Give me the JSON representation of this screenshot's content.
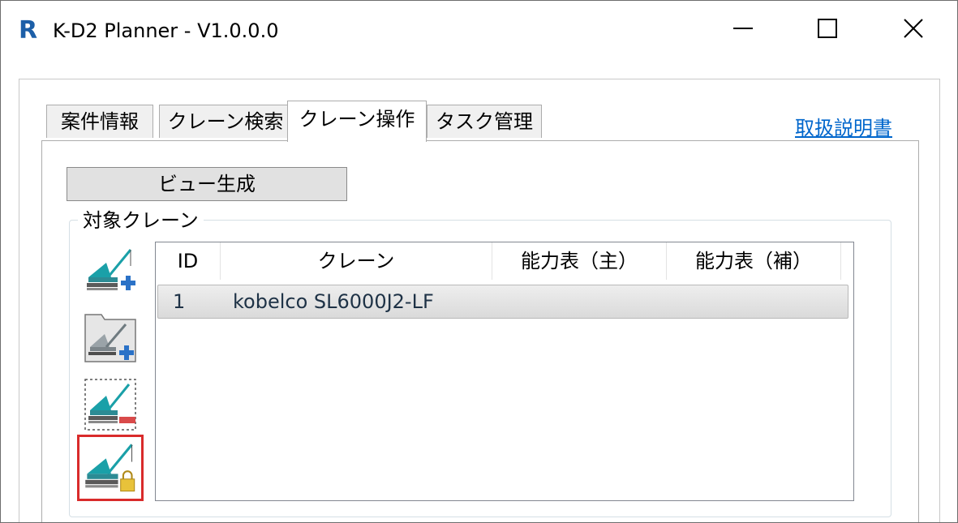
{
  "window": {
    "logo_text": "R",
    "title": "K-D2 Planner - V1.0.0.0",
    "controls": [
      "minimize",
      "maximize",
      "close"
    ]
  },
  "tabs": [
    {
      "label": "案件情報",
      "active": false
    },
    {
      "label": "クレーン検索",
      "active": false
    },
    {
      "label": "クレーン操作",
      "active": true
    },
    {
      "label": "タスク管理",
      "active": false
    }
  ],
  "manual_link": "取扱説明書",
  "panel": {
    "view_button_label": "ビュー生成",
    "group_label": "対象クレーン",
    "side_buttons": [
      {
        "icon": "add-crane-icon",
        "selected": false
      },
      {
        "icon": "add-crane-from-folder-icon",
        "selected": false
      },
      {
        "icon": "remove-crane-icon",
        "selected": false
      },
      {
        "icon": "lock-crane-icon",
        "selected": true
      }
    ],
    "table": {
      "columns": [
        "ID",
        "クレーン",
        "能力表（主）",
        "能力表（補）"
      ],
      "rows": [
        {
          "id": "1",
          "crane": "kobelco SL6000J2-LF",
          "main": "",
          "aux": ""
        }
      ]
    }
  },
  "colors": {
    "accent": "#1c5fa8",
    "link": "#0066cc",
    "selected_border": "#d92b2b",
    "crane_teal": "#1aa0a8"
  }
}
